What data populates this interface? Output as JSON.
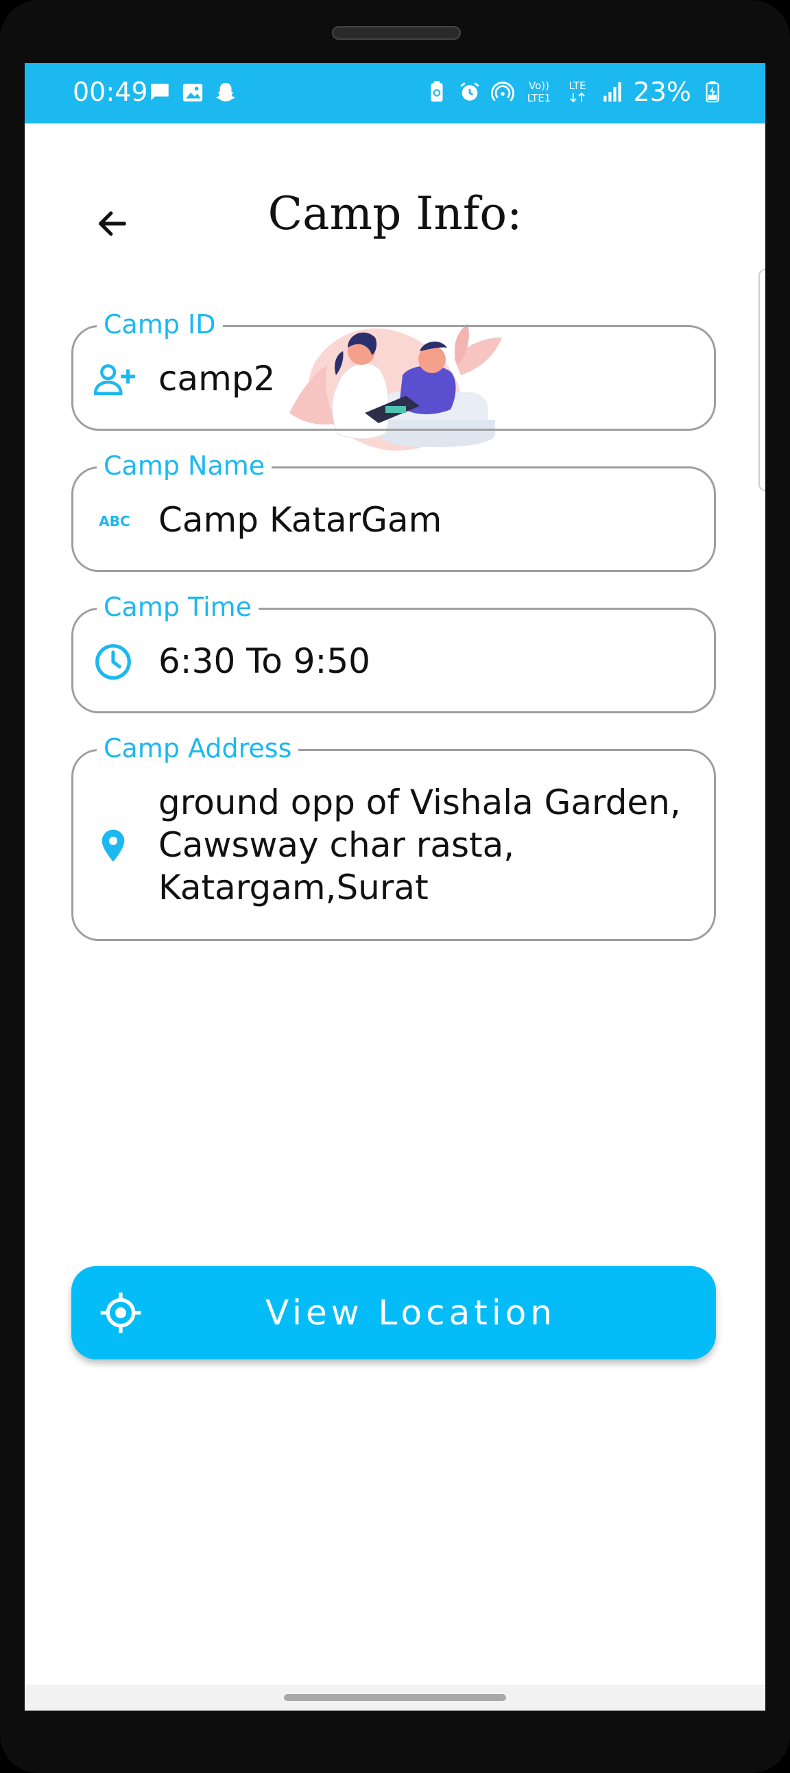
{
  "status_bar": {
    "time": "00:49",
    "battery": "23%",
    "left_icons": [
      "message-icon",
      "gallery-icon",
      "snapchat-icon"
    ],
    "right_icons": [
      "recycle-battery-icon",
      "alarm-icon",
      "hotspot-icon",
      "volte-icon",
      "lte-icon",
      "signal-icon",
      "battery-charging-icon"
    ],
    "volte_line1": "Vo))",
    "volte_line2": "LTE1",
    "lte_text": "LTE",
    "color": "#1cb8f0"
  },
  "header": {
    "title": "Camp Info:",
    "back_icon": "back-arrow-icon"
  },
  "illustration": {
    "icon": "doctor-patient-illustration"
  },
  "fields": {
    "camp_id": {
      "label": "Camp ID",
      "value": "camp2",
      "icon": "add-person-icon"
    },
    "camp_name": {
      "label": "Camp Name",
      "value": "Camp KatarGam",
      "icon": "abc-icon",
      "icon_text": "ABC"
    },
    "camp_time": {
      "label": "Camp Time",
      "value": "6:30 To 9:50",
      "icon": "clock-icon"
    },
    "camp_address": {
      "label": "Camp Address",
      "value": "ground opp of Vishala Garden,\nCawsway char rasta,\nKatargam,Surat",
      "icon": "location-pin-icon"
    }
  },
  "actions": {
    "view_location": {
      "label": "View Location",
      "icon": "gps-target-icon"
    }
  },
  "theme": {
    "accent": "#1cb8f0",
    "button": "#04bdf8",
    "border": "#9e9e9e"
  }
}
